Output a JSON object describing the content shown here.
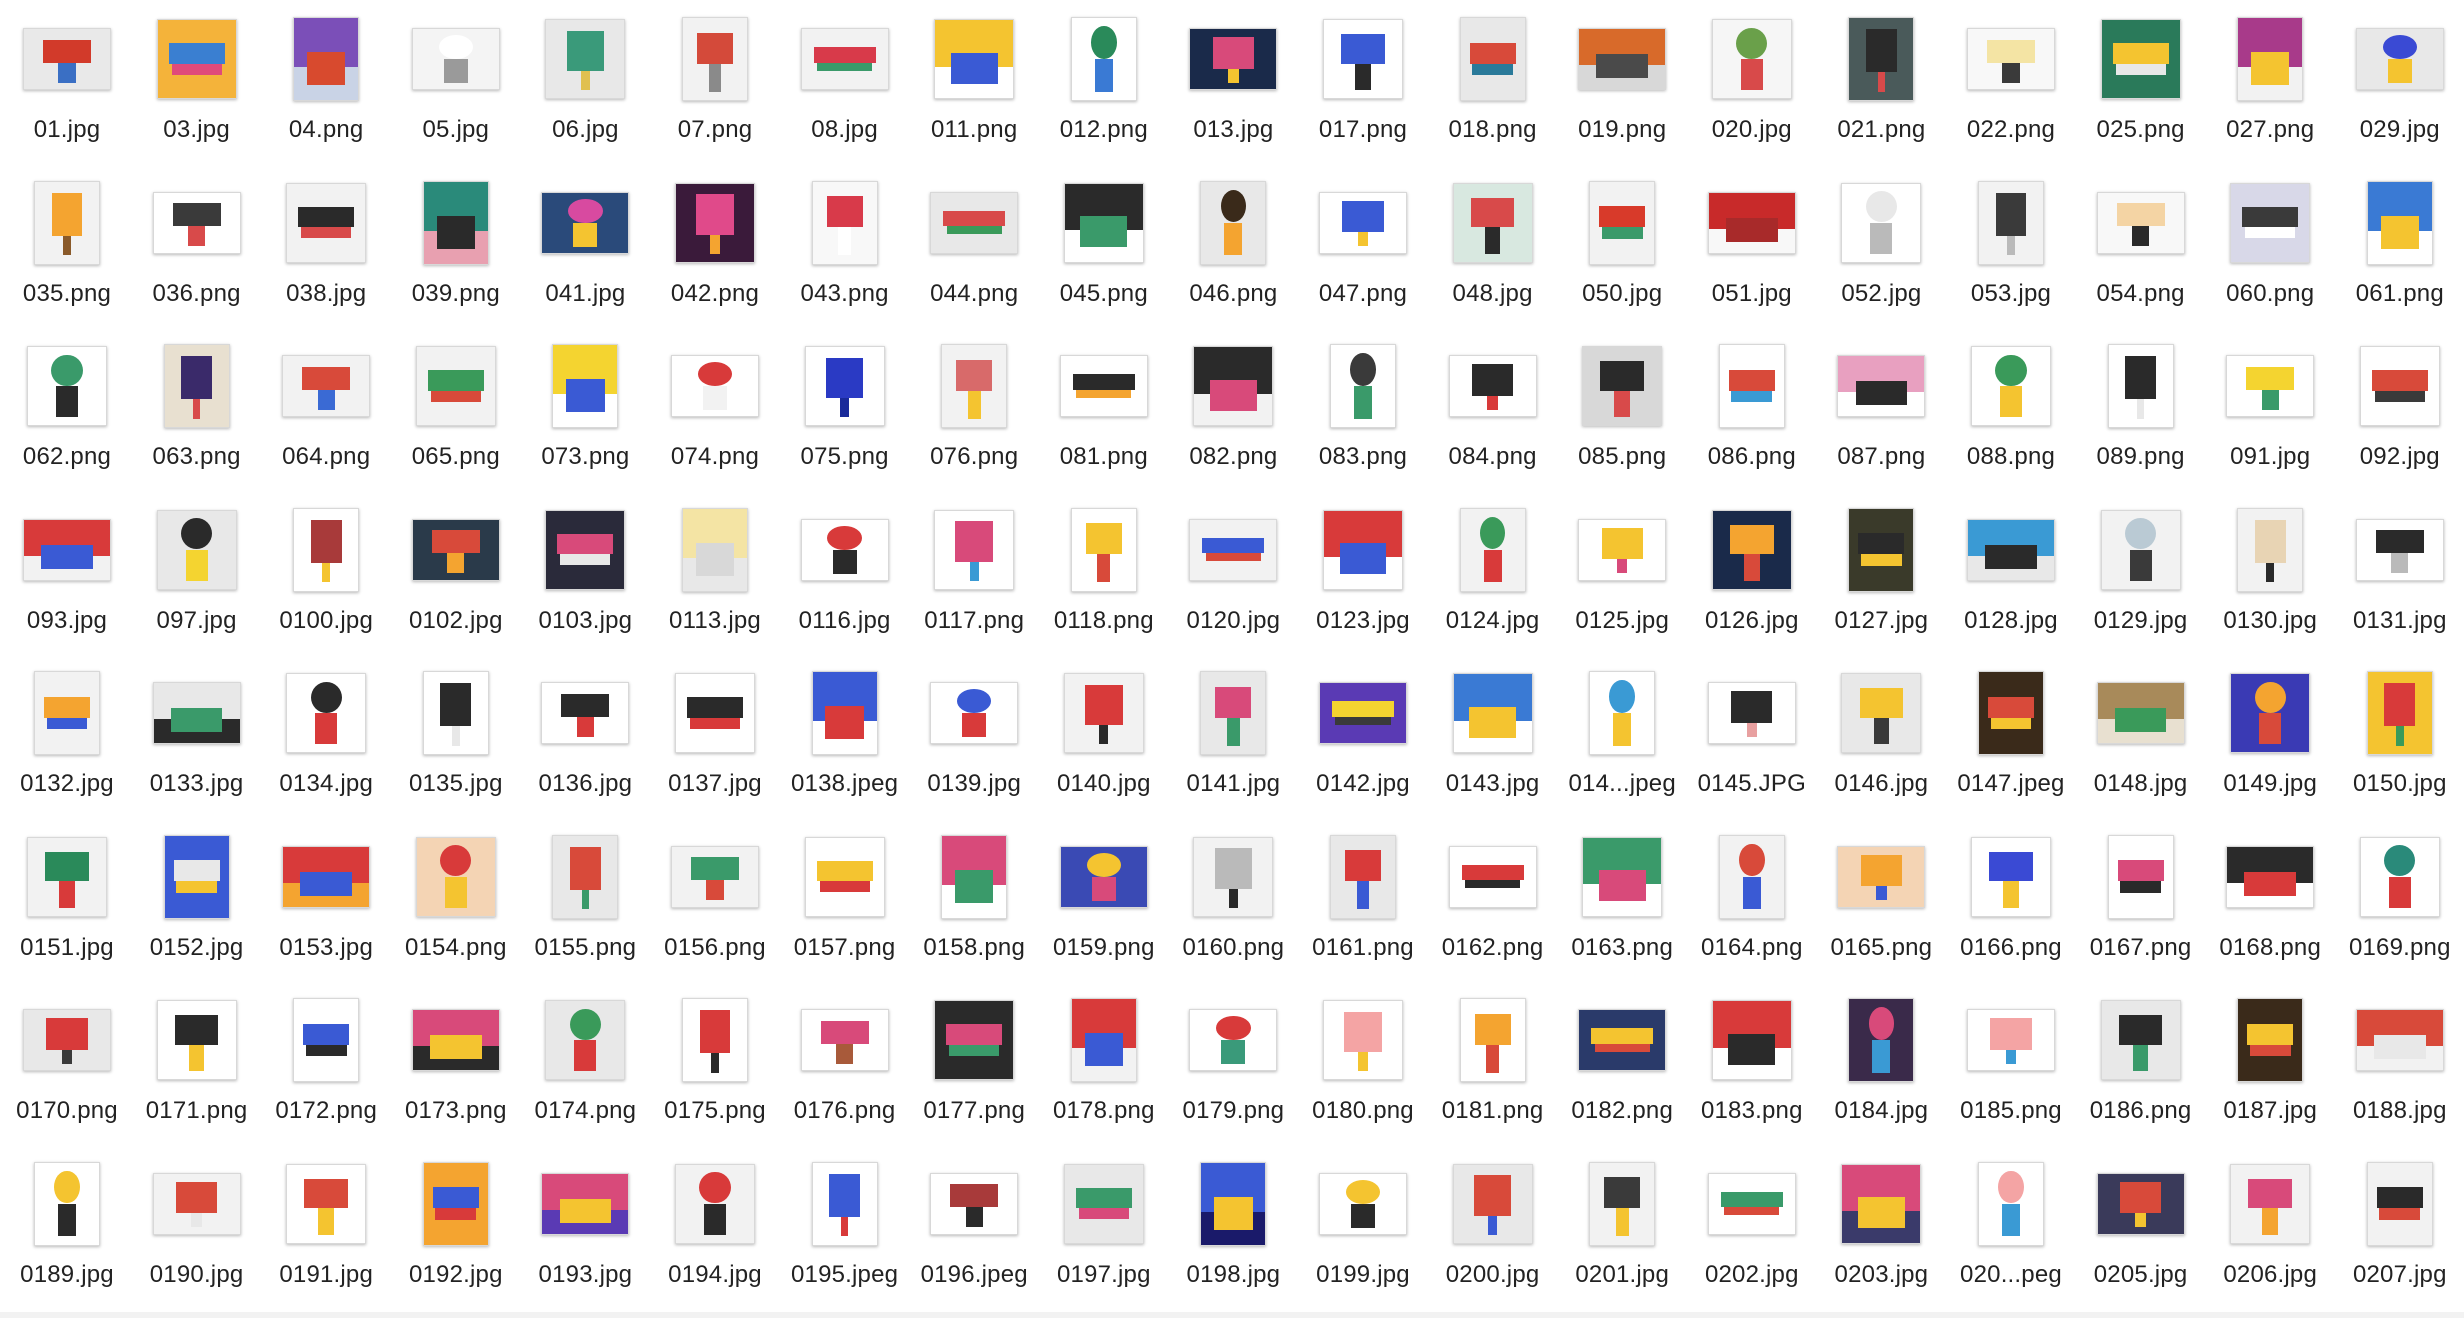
{
  "files": [
    {
      "name": "01.jpg",
      "colors": [
        "#e9e9e9",
        "#d23a2a",
        "#3a6fc4"
      ]
    },
    {
      "name": "03.jpg",
      "colors": [
        "#f4b33a",
        "#3a7fd1",
        "#e04a7a"
      ]
    },
    {
      "name": "04.png",
      "colors": [
        "#c9d3e6",
        "#7b4fb8",
        "#d84a2e"
      ]
    },
    {
      "name": "05.jpg",
      "colors": [
        "#f4f4f4",
        "#ffffff",
        "#9a9a9a"
      ]
    },
    {
      "name": "06.jpg",
      "colors": [
        "#e8e8e8",
        "#3a9a7a",
        "#e0c050"
      ]
    },
    {
      "name": "07.png",
      "colors": [
        "#f2f2f2",
        "#d44a3a",
        "#8a8a8a"
      ]
    },
    {
      "name": "08.jpg",
      "colors": [
        "#f2f2f2",
        "#d83a4a",
        "#3a9a6a"
      ]
    },
    {
      "name": "011.png",
      "colors": [
        "#ffffff",
        "#f4c430",
        "#3a5ad4"
      ]
    },
    {
      "name": "012.png",
      "colors": [
        "#ffffff",
        "#2a8a5a",
        "#3a7ad4"
      ]
    },
    {
      "name": "013.jpg",
      "colors": [
        "#1a2a4a",
        "#d84a7a",
        "#f4c430"
      ]
    },
    {
      "name": "017.png",
      "colors": [
        "#ffffff",
        "#3a5ad4",
        "#2a2a2a"
      ]
    },
    {
      "name": "018.png",
      "colors": [
        "#e8e8e8",
        "#d84a3a",
        "#2a7a9a"
      ]
    },
    {
      "name": "019.png",
      "colors": [
        "#d8d8d8",
        "#d86a2a",
        "#4a4a4a"
      ]
    },
    {
      "name": "020.jpg",
      "colors": [
        "#f6f6f6",
        "#6aa04a",
        "#d84a4a"
      ]
    },
    {
      "name": "021.png",
      "colors": [
        "#4a5a5a",
        "#2a2a2a",
        "#d84a4a"
      ]
    },
    {
      "name": "022.png",
      "colors": [
        "#f8f8f8",
        "#f4e4a4",
        "#3a3a3a"
      ]
    },
    {
      "name": "025.png",
      "colors": [
        "#2a7a5a",
        "#f4c430",
        "#e8e8e8"
      ]
    },
    {
      "name": "027.png",
      "colors": [
        "#f2f2f2",
        "#a83a8a",
        "#f4c430"
      ]
    },
    {
      "name": "029.jpg",
      "colors": [
        "#e8e8e8",
        "#3a4ad4",
        "#f4c430"
      ]
    },
    {
      "name": "035.png",
      "colors": [
        "#f2f2f2",
        "#f4a430",
        "#8a5a2a"
      ]
    },
    {
      "name": "036.png",
      "colors": [
        "#ffffff",
        "#3a3a3a",
        "#d84a4a"
      ]
    },
    {
      "name": "038.jpg",
      "colors": [
        "#f2f2f2",
        "#2a2a2a",
        "#d84a4a"
      ]
    },
    {
      "name": "039.png",
      "colors": [
        "#e8a0b0",
        "#2a8a7a",
        "#2a2a2a"
      ]
    },
    {
      "name": "041.jpg",
      "colors": [
        "#2a4a7a",
        "#d84aa0",
        "#f4c430"
      ]
    },
    {
      "name": "042.png",
      "colors": [
        "#3a1a3a",
        "#e04a8a",
        "#f4a430"
      ]
    },
    {
      "name": "043.png",
      "colors": [
        "#f8f8f8",
        "#d83a4a",
        "#ffffff"
      ]
    },
    {
      "name": "044.png",
      "colors": [
        "#e8e8e8",
        "#d84a4a",
        "#3a9a5a"
      ]
    },
    {
      "name": "045.png",
      "colors": [
        "#ffffff",
        "#2a2a2a",
        "#3a9a6a"
      ]
    },
    {
      "name": "046.png",
      "colors": [
        "#e8e8e8",
        "#3a2a1a",
        "#f4a430"
      ]
    },
    {
      "name": "047.png",
      "colors": [
        "#ffffff",
        "#3a5ad4",
        "#f4c430"
      ]
    },
    {
      "name": "048.jpg",
      "colors": [
        "#d8e8e0",
        "#d84a4a",
        "#2a2a2a"
      ]
    },
    {
      "name": "050.jpg",
      "colors": [
        "#f2f2f2",
        "#d83a2a",
        "#3a9a6a"
      ]
    },
    {
      "name": "051.jpg",
      "colors": [
        "#f8f8f8",
        "#c82a2a",
        "#a82a2a"
      ]
    },
    {
      "name": "052.jpg",
      "colors": [
        "#ffffff",
        "#e8e8e8",
        "#bababa"
      ]
    },
    {
      "name": "053.jpg",
      "colors": [
        "#f2f2f2",
        "#3a3a3a",
        "#bababa"
      ]
    },
    {
      "name": "054.png",
      "colors": [
        "#f8f8f8",
        "#f4d4a4",
        "#2a2a2a"
      ]
    },
    {
      "name": "060.png",
      "colors": [
        "#d8d8e8",
        "#3a3a3a",
        "#ffffff"
      ]
    },
    {
      "name": "061.png",
      "colors": [
        "#ffffff",
        "#3a7ad4",
        "#f4c430"
      ]
    },
    {
      "name": "062.png",
      "colors": [
        "#ffffff",
        "#3a9a6a",
        "#2a2a2a"
      ]
    },
    {
      "name": "063.png",
      "colors": [
        "#e8e0d0",
        "#3a2a6a",
        "#d84a4a"
      ]
    },
    {
      "name": "064.png",
      "colors": [
        "#f2f2f2",
        "#d84a3a",
        "#3a6ad4"
      ]
    },
    {
      "name": "065.png",
      "colors": [
        "#f2f2f2",
        "#3a9a5a",
        "#d84a3a"
      ]
    },
    {
      "name": "073.png",
      "colors": [
        "#ffffff",
        "#f4d430",
        "#3a5ad4"
      ]
    },
    {
      "name": "074.png",
      "colors": [
        "#ffffff",
        "#d83a3a",
        "#f2f2f2"
      ]
    },
    {
      "name": "075.png",
      "colors": [
        "#ffffff",
        "#2a3ac4",
        "#1a2a9a"
      ]
    },
    {
      "name": "076.png",
      "colors": [
        "#f2f2f2",
        "#d86a6a",
        "#f4c430"
      ]
    },
    {
      "name": "081.png",
      "colors": [
        "#ffffff",
        "#2a2a2a",
        "#f4a430"
      ]
    },
    {
      "name": "082.png",
      "colors": [
        "#f2f2f2",
        "#2a2a2a",
        "#d84a7a"
      ]
    },
    {
      "name": "083.png",
      "colors": [
        "#ffffff",
        "#3a3a3a",
        "#3a9a6a"
      ]
    },
    {
      "name": "084.png",
      "colors": [
        "#ffffff",
        "#2a2a2a",
        "#d83a3a"
      ]
    },
    {
      "name": "085.png",
      "colors": [
        "#d8d8d8",
        "#2a2a2a",
        "#d84a4a"
      ]
    },
    {
      "name": "086.png",
      "colors": [
        "#ffffff",
        "#d84a3a",
        "#3a9ad4"
      ]
    },
    {
      "name": "087.png",
      "colors": [
        "#ffffff",
        "#e8a0c0",
        "#2a2a2a"
      ]
    },
    {
      "name": "088.png",
      "colors": [
        "#ffffff",
        "#3a9a5a",
        "#f4c430"
      ]
    },
    {
      "name": "089.png",
      "colors": [
        "#ffffff",
        "#2a2a2a",
        "#e8e8e8"
      ]
    },
    {
      "name": "091.jpg",
      "colors": [
        "#ffffff",
        "#f4d430",
        "#3a9a6a"
      ]
    },
    {
      "name": "092.jpg",
      "colors": [
        "#ffffff",
        "#d84a3a",
        "#3a3a3a"
      ]
    },
    {
      "name": "093.jpg",
      "colors": [
        "#f2f2f2",
        "#d83a3a",
        "#3a5ad4"
      ]
    },
    {
      "name": "097.jpg",
      "colors": [
        "#e8e8e8",
        "#2a2a2a",
        "#f4d430"
      ]
    },
    {
      "name": "0100.jpg",
      "colors": [
        "#ffffff",
        "#a83a3a",
        "#f4c430"
      ]
    },
    {
      "name": "0102.jpg",
      "colors": [
        "#2a3a4a",
        "#d84a3a",
        "#f4a430"
      ]
    },
    {
      "name": "0103.jpg",
      "colors": [
        "#2a2a3a",
        "#d84a7a",
        "#e8e8e8"
      ]
    },
    {
      "name": "0113.jpg",
      "colors": [
        "#e8e8e8",
        "#f4e4a4",
        "#d8d8d8"
      ]
    },
    {
      "name": "0116.jpg",
      "colors": [
        "#ffffff",
        "#d83a3a",
        "#2a2a2a"
      ]
    },
    {
      "name": "0117.png",
      "colors": [
        "#ffffff",
        "#d84a7a",
        "#3a9ad4"
      ]
    },
    {
      "name": "0118.png",
      "colors": [
        "#ffffff",
        "#f4c430",
        "#d84a3a"
      ]
    },
    {
      "name": "0120.jpg",
      "colors": [
        "#f2f2f2",
        "#3a5ad4",
        "#d84a3a"
      ]
    },
    {
      "name": "0123.jpg",
      "colors": [
        "#ffffff",
        "#d83a3a",
        "#3a5ad4"
      ]
    },
    {
      "name": "0124.jpg",
      "colors": [
        "#f2f2f2",
        "#3a9a5a",
        "#d83a3a"
      ]
    },
    {
      "name": "0125.jpg",
      "colors": [
        "#ffffff",
        "#f4c430",
        "#d84a7a"
      ]
    },
    {
      "name": "0126.jpg",
      "colors": [
        "#1a2a4a",
        "#f4a430",
        "#d84a3a"
      ]
    },
    {
      "name": "0127.jpg",
      "colors": [
        "#3a3a2a",
        "#2a2a2a",
        "#f4c430"
      ]
    },
    {
      "name": "0128.jpg",
      "colors": [
        "#e8e8e8",
        "#3a9ad4",
        "#2a2a2a"
      ]
    },
    {
      "name": "0129.jpg",
      "colors": [
        "#f2f2f2",
        "#bacad4",
        "#3a3a3a"
      ]
    },
    {
      "name": "0130.jpg",
      "colors": [
        "#f2f2f2",
        "#e8d4b4",
        "#2a2a2a"
      ]
    },
    {
      "name": "0131.jpg",
      "colors": [
        "#ffffff",
        "#2a2a2a",
        "#bababa"
      ]
    },
    {
      "name": "0132.jpg",
      "colors": [
        "#f2f2f2",
        "#f4a430",
        "#3a5ad4"
      ]
    },
    {
      "name": "0133.jpg",
      "colors": [
        "#2a2a2a",
        "#e8e8e8",
        "#3a9a6a"
      ]
    },
    {
      "name": "0134.jpg",
      "colors": [
        "#ffffff",
        "#2a2a2a",
        "#d83a3a"
      ]
    },
    {
      "name": "0135.jpg",
      "colors": [
        "#ffffff",
        "#2a2a2a",
        "#e8e8e8"
      ]
    },
    {
      "name": "0136.jpg",
      "colors": [
        "#ffffff",
        "#2a2a2a",
        "#d83a3a"
      ]
    },
    {
      "name": "0137.jpg",
      "colors": [
        "#ffffff",
        "#2a2a2a",
        "#d83a3a"
      ]
    },
    {
      "name": "0138.jpeg",
      "colors": [
        "#ffffff",
        "#3a5ad4",
        "#d83a3a"
      ]
    },
    {
      "name": "0139.jpg",
      "colors": [
        "#ffffff",
        "#3a5ad4",
        "#d83a3a"
      ]
    },
    {
      "name": "0140.jpg",
      "colors": [
        "#f2f2f2",
        "#d83a3a",
        "#2a2a2a"
      ]
    },
    {
      "name": "0141.jpg",
      "colors": [
        "#e8e8e8",
        "#d84a7a",
        "#3a9a6a"
      ]
    },
    {
      "name": "0142.jpg",
      "colors": [
        "#5a3ab4",
        "#f4d430",
        "#3a3a3a"
      ]
    },
    {
      "name": "0143.jpg",
      "colors": [
        "#ffffff",
        "#3a7ad4",
        "#f4c430"
      ]
    },
    {
      "name": "014...jpeg",
      "colors": [
        "#ffffff",
        "#3a9ad4",
        "#f4c430"
      ]
    },
    {
      "name": "0145.JPG",
      "colors": [
        "#ffffff",
        "#2a2a2a",
        "#e8a0a0"
      ]
    },
    {
      "name": "0146.jpg",
      "colors": [
        "#e8e8e8",
        "#f4c430",
        "#3a3a3a"
      ]
    },
    {
      "name": "0147.jpeg",
      "colors": [
        "#3a2a1a",
        "#d84a3a",
        "#f4c430"
      ]
    },
    {
      "name": "0148.jpg",
      "colors": [
        "#e8e0d0",
        "#a88a5a",
        "#3a9a5a"
      ]
    },
    {
      "name": "0149.jpg",
      "colors": [
        "#3a3ab4",
        "#f4a430",
        "#d84a3a"
      ]
    },
    {
      "name": "0150.jpg",
      "colors": [
        "#f4c430",
        "#d83a3a",
        "#3a9a5a"
      ]
    },
    {
      "name": "0151.jpg",
      "colors": [
        "#f2f2f2",
        "#2a8a5a",
        "#d83a3a"
      ]
    },
    {
      "name": "0152.jpg",
      "colors": [
        "#3a5ad4",
        "#e8e8e8",
        "#f4c430"
      ]
    },
    {
      "name": "0153.jpg",
      "colors": [
        "#f4a430",
        "#d83a3a",
        "#3a5ad4"
      ]
    },
    {
      "name": "0154.png",
      "colors": [
        "#f4d4b4",
        "#d83a3a",
        "#f4c430"
      ]
    },
    {
      "name": "0155.png",
      "colors": [
        "#e8e8e8",
        "#d84a3a",
        "#3a9a6a"
      ]
    },
    {
      "name": "0156.png",
      "colors": [
        "#f2f2f2",
        "#3a9a6a",
        "#d84a3a"
      ]
    },
    {
      "name": "0157.png",
      "colors": [
        "#ffffff",
        "#f4c430",
        "#d83a3a"
      ]
    },
    {
      "name": "0158.png",
      "colors": [
        "#ffffff",
        "#d84a7a",
        "#3a9a6a"
      ]
    },
    {
      "name": "0159.png",
      "colors": [
        "#3a4ab4",
        "#f4c430",
        "#d84a7a"
      ]
    },
    {
      "name": "0160.png",
      "colors": [
        "#f2f2f2",
        "#bababa",
        "#2a2a2a"
      ]
    },
    {
      "name": "0161.png",
      "colors": [
        "#e8e8e8",
        "#d83a3a",
        "#3a5ad4"
      ]
    },
    {
      "name": "0162.png",
      "colors": [
        "#ffffff",
        "#d83a3a",
        "#2a2a2a"
      ]
    },
    {
      "name": "0163.png",
      "colors": [
        "#ffffff",
        "#3a9a6a",
        "#d84a7a"
      ]
    },
    {
      "name": "0164.png",
      "colors": [
        "#f2f2f2",
        "#d84a3a",
        "#3a5ad4"
      ]
    },
    {
      "name": "0165.png",
      "colors": [
        "#f4d4b4",
        "#f4a430",
        "#3a5ad4"
      ]
    },
    {
      "name": "0166.png",
      "colors": [
        "#ffffff",
        "#3a4ad4",
        "#f4c430"
      ]
    },
    {
      "name": "0167.png",
      "colors": [
        "#ffffff",
        "#d84a7a",
        "#2a2a2a"
      ]
    },
    {
      "name": "0168.png",
      "colors": [
        "#ffffff",
        "#2a2a2a",
        "#d83a3a"
      ]
    },
    {
      "name": "0169.png",
      "colors": [
        "#ffffff",
        "#2a8a7a",
        "#d83a3a"
      ]
    },
    {
      "name": "0170.png",
      "colors": [
        "#e8e8e8",
        "#d83a3a",
        "#3a3a3a"
      ]
    },
    {
      "name": "0171.png",
      "colors": [
        "#ffffff",
        "#2a2a2a",
        "#f4c430"
      ]
    },
    {
      "name": "0172.png",
      "colors": [
        "#ffffff",
        "#3a5ad4",
        "#2a2a2a"
      ]
    },
    {
      "name": "0173.png",
      "colors": [
        "#2a2a2a",
        "#d84a7a",
        "#f4c430"
      ]
    },
    {
      "name": "0174.png",
      "colors": [
        "#e8e8e8",
        "#3a9a5a",
        "#d83a3a"
      ]
    },
    {
      "name": "0175.png",
      "colors": [
        "#ffffff",
        "#d83a3a",
        "#2a2a2a"
      ]
    },
    {
      "name": "0176.png",
      "colors": [
        "#ffffff",
        "#d84a7a",
        "#a85a3a"
      ]
    },
    {
      "name": "0177.png",
      "colors": [
        "#2a2a2a",
        "#d84a7a",
        "#3a9a6a"
      ]
    },
    {
      "name": "0178.png",
      "colors": [
        "#f2f2f2",
        "#d83a3a",
        "#3a5ad4"
      ]
    },
    {
      "name": "0179.png",
      "colors": [
        "#ffffff",
        "#d83a3a",
        "#3a9a7a"
      ]
    },
    {
      "name": "0180.png",
      "colors": [
        "#ffffff",
        "#f4a4a4",
        "#f4c430"
      ]
    },
    {
      "name": "0181.png",
      "colors": [
        "#ffffff",
        "#f4a430",
        "#d84a3a"
      ]
    },
    {
      "name": "0182.png",
      "colors": [
        "#2a3a6a",
        "#f4c430",
        "#d84a3a"
      ]
    },
    {
      "name": "0183.png",
      "colors": [
        "#ffffff",
        "#d83a3a",
        "#2a2a2a"
      ]
    },
    {
      "name": "0184.jpg",
      "colors": [
        "#3a2a4a",
        "#d84a7a",
        "#3a9ad4"
      ]
    },
    {
      "name": "0185.png",
      "colors": [
        "#ffffff",
        "#f4a4a4",
        "#3a9ad4"
      ]
    },
    {
      "name": "0186.png",
      "colors": [
        "#e8e8e8",
        "#2a2a2a",
        "#3a9a6a"
      ]
    },
    {
      "name": "0187.jpg",
      "colors": [
        "#3a2a1a",
        "#f4c430",
        "#d84a3a"
      ]
    },
    {
      "name": "0188.jpg",
      "colors": [
        "#f2f2f2",
        "#d84a3a",
        "#e8e8e8"
      ]
    },
    {
      "name": "0189.jpg",
      "colors": [
        "#ffffff",
        "#f4c430",
        "#2a2a2a"
      ]
    },
    {
      "name": "0190.jpg",
      "colors": [
        "#f2f2f2",
        "#d84a3a",
        "#e8e8e8"
      ]
    },
    {
      "name": "0191.jpg",
      "colors": [
        "#ffffff",
        "#d84a3a",
        "#f4c430"
      ]
    },
    {
      "name": "0192.jpg",
      "colors": [
        "#f4a430",
        "#3a5ad4",
        "#d83a3a"
      ]
    },
    {
      "name": "0193.jpg",
      "colors": [
        "#5a3ab4",
        "#d84a7a",
        "#f4c430"
      ]
    },
    {
      "name": "0194.jpg",
      "colors": [
        "#f2f2f2",
        "#d83a3a",
        "#2a2a2a"
      ]
    },
    {
      "name": "0195.jpeg",
      "colors": [
        "#ffffff",
        "#3a5ad4",
        "#d83a3a"
      ]
    },
    {
      "name": "0196.jpeg",
      "colors": [
        "#ffffff",
        "#a83a3a",
        "#2a2a2a"
      ]
    },
    {
      "name": "0197.jpg",
      "colors": [
        "#e8e8e8",
        "#3a9a6a",
        "#d84a7a"
      ]
    },
    {
      "name": "0198.jpg",
      "colors": [
        "#1a1a6a",
        "#3a5ad4",
        "#f4c430"
      ]
    },
    {
      "name": "0199.jpg",
      "colors": [
        "#ffffff",
        "#f4c430",
        "#2a2a2a"
      ]
    },
    {
      "name": "0200.jpg",
      "colors": [
        "#e8e8e8",
        "#d84a3a",
        "#3a5ad4"
      ]
    },
    {
      "name": "0201.jpg",
      "colors": [
        "#f2f2f2",
        "#3a3a3a",
        "#f4c430"
      ]
    },
    {
      "name": "0202.jpg",
      "colors": [
        "#ffffff",
        "#3a9a6a",
        "#d84a3a"
      ]
    },
    {
      "name": "0203.jpg",
      "colors": [
        "#3a3a6a",
        "#d84a7a",
        "#f4c430"
      ]
    },
    {
      "name": "020...peg",
      "colors": [
        "#ffffff",
        "#f4a4a4",
        "#3a9ad4"
      ]
    },
    {
      "name": "0205.jpg",
      "colors": [
        "#3a3a5a",
        "#d84a3a",
        "#f4c430"
      ]
    },
    {
      "name": "0206.jpg",
      "colors": [
        "#f2f2f2",
        "#d84a7a",
        "#f4a430"
      ]
    },
    {
      "name": "0207.jpg",
      "colors": [
        "#f2f2f2",
        "#2a2a2a",
        "#d84a3a"
      ]
    }
  ]
}
